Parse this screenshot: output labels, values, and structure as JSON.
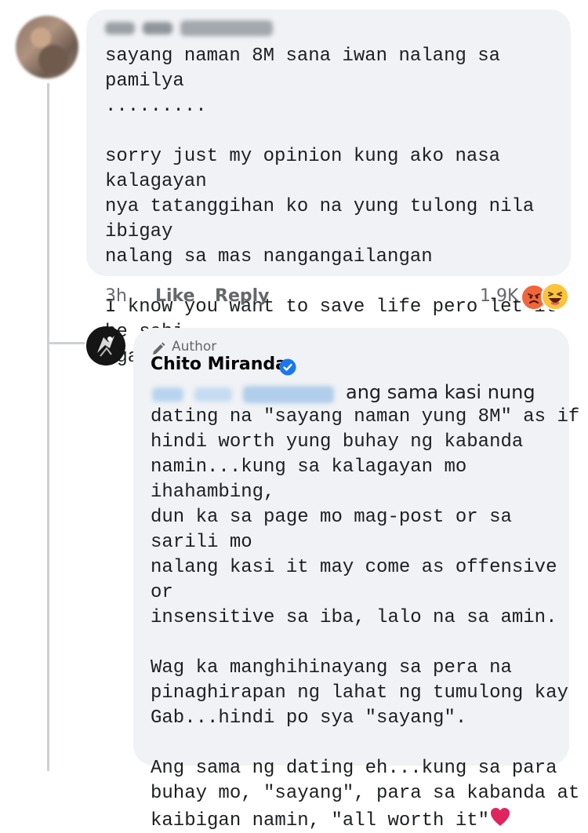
{
  "comment": {
    "text": "sayang naman 8M sana iwan nalang sa pamilya\n.........\n\nsorry just my opinion kung ako nasa kalagayan\nnya tatanggihan ko na yung tulong nila ibigay\nnalang sa mas nangangailangan\n\nI know you want to save life pero let it be sabi\nnga ng Beatles",
    "time": "3h",
    "like_label": "Like",
    "reply_label": "Reply",
    "reaction_count": "1.9K"
  },
  "reply": {
    "author_badge": "Author",
    "author_name": "Chito Miranda",
    "first_line_rest": "ang sama kasi nung",
    "text": "dating na \"sayang naman yung 8M\" as if\nhindi worth yung buhay ng kabanda\nnamin...kung sa kalagayan mo ihahambing,\ndun ka sa page mo mag-post or sa sarili mo\nnalang kasi it may come as offensive or\ninsensitive sa iba, lalo na sa amin.\n\nWag ka manghihinayang sa pera na\npinaghirapan ng lahat ng tumulong kay\nGab...hindi po sya \"sayang\".\n\nAng sama ng dating eh...kung sa para\nbuhay mo, \"sayang\", para sa kabanda at\nkaibigan namin, \"all worth it\""
  },
  "colors": {
    "bubble": "#f0f2f5",
    "verified": "#1877f2",
    "angry_reaction": "#f0663a",
    "haha_reaction": "#fcc33d",
    "heart": "#e0245e"
  }
}
